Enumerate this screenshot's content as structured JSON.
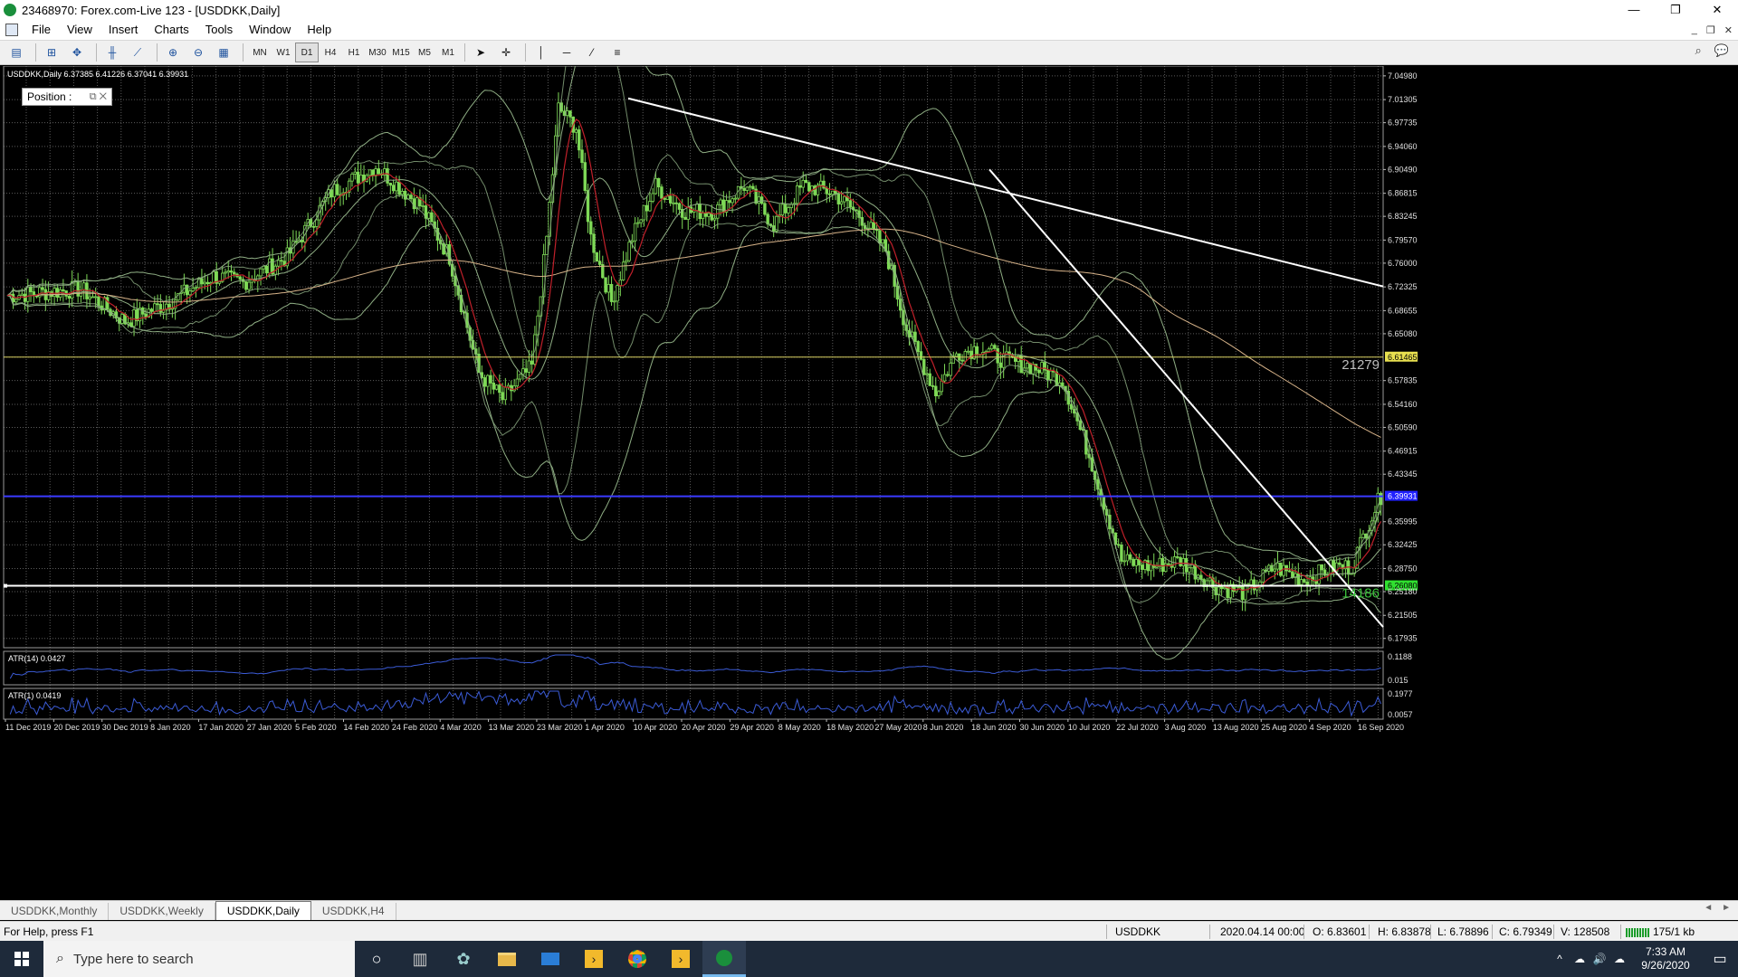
{
  "window": {
    "title": "23468970: Forex.com-Live 123 - [USDDKK,Daily]",
    "controls": [
      "—",
      "❐",
      "✕"
    ]
  },
  "menu": {
    "items": [
      "File",
      "View",
      "Insert",
      "Charts",
      "Tools",
      "Window",
      "Help"
    ],
    "mdi_controls": [
      "_",
      "❐",
      "✕"
    ]
  },
  "toolbar": {
    "timeframes": [
      "MN",
      "W1",
      "D1",
      "H4",
      "H1",
      "M30",
      "M15",
      "M5",
      "M1"
    ],
    "active_timeframe": "D1"
  },
  "chart": {
    "info": "USDDKK,Daily  6.37385 6.41226 6.37041 6.39931",
    "position_widget": "Position :",
    "price_labels": [
      "7.04980",
      "7.01305",
      "6.97735",
      "6.94060",
      "6.90490",
      "6.86815",
      "6.83245",
      "6.79570",
      "6.76000",
      "6.72325",
      "6.68655",
      "6.65080",
      "6.61465",
      "6.57835",
      "6.54160",
      "6.50590",
      "6.46915",
      "6.43345",
      "6.39931",
      "6.35995",
      "6.32425",
      "6.28750",
      "6.26080",
      "6.25180",
      "6.21505",
      "6.17935"
    ],
    "highlight_labels": {
      "yellow": "6.61465",
      "blue": "6.39931",
      "green": "6.26080"
    },
    "line_labels": {
      "upper": "21279",
      "lower": "14186"
    },
    "date_labels": [
      "11 Dec 2019",
      "20 Dec 2019",
      "30 Dec 2019",
      "8 Jan 2020",
      "17 Jan 2020",
      "27 Jan 2020",
      "5 Feb 2020",
      "14 Feb 2020",
      "24 Feb 2020",
      "4 Mar 2020",
      "13 Mar 2020",
      "23 Mar 2020",
      "1 Apr 2020",
      "10 Apr 2020",
      "20 Apr 2020",
      "29 Apr 2020",
      "8 May 2020",
      "18 May 2020",
      "27 May 2020",
      "8 Jun 2020",
      "18 Jun 2020",
      "30 Jun 2020",
      "10 Jul 2020",
      "22 Jul 2020",
      "3 Aug 2020",
      "13 Aug 2020",
      "25 Aug 2020",
      "4 Sep 2020",
      "16 Sep 2020"
    ],
    "atr14": {
      "label": "ATR(14) 0.0427",
      "scale": [
        "0.1188",
        "0.015"
      ]
    },
    "atr1": {
      "label": "ATR(1) 0.0419",
      "scale": [
        "0.1977",
        "0.0057"
      ]
    },
    "colors": {
      "candle": "#7ed957",
      "grid": "#7a7a7a",
      "trend": "#ffffff",
      "ma_fast": "#c0202a",
      "ma_slow": "#d8b48a",
      "band": "#8fae84",
      "hline_yellow": "#d8d060",
      "hline_blue": "#3a3aff",
      "atr": "#3b5bd6"
    }
  },
  "chart_data": {
    "type": "candlestick",
    "symbol": "USDDKK",
    "timeframe": "Daily",
    "ohlc_last": {
      "open": 6.37385,
      "high": 6.41226,
      "low": 6.37041,
      "close": 6.39931
    },
    "path": [
      [
        0,
        6.71
      ],
      [
        25,
        6.72
      ],
      [
        40,
        6.67
      ],
      [
        55,
        6.7
      ],
      [
        70,
        6.74
      ],
      [
        80,
        6.73
      ],
      [
        95,
        6.77
      ],
      [
        110,
        6.87
      ],
      [
        125,
        6.91
      ],
      [
        140,
        6.85
      ],
      [
        150,
        6.77
      ],
      [
        160,
        6.59
      ],
      [
        168,
        6.55
      ],
      [
        178,
        6.6
      ],
      [
        183,
        6.8
      ],
      [
        187,
        7.0
      ],
      [
        193,
        6.97
      ],
      [
        198,
        6.8
      ],
      [
        205,
        6.7
      ],
      [
        212,
        6.8
      ],
      [
        220,
        6.88
      ],
      [
        230,
        6.84
      ],
      [
        240,
        6.84
      ],
      [
        250,
        6.88
      ],
      [
        260,
        6.82
      ],
      [
        270,
        6.88
      ],
      [
        280,
        6.87
      ],
      [
        290,
        6.83
      ],
      [
        298,
        6.78
      ],
      [
        305,
        6.66
      ],
      [
        315,
        6.56
      ],
      [
        322,
        6.62
      ],
      [
        330,
        6.63
      ],
      [
        338,
        6.61
      ],
      [
        348,
        6.6
      ],
      [
        358,
        6.58
      ],
      [
        368,
        6.45
      ],
      [
        378,
        6.3
      ],
      [
        388,
        6.29
      ],
      [
        398,
        6.3
      ],
      [
        410,
        6.26
      ],
      [
        420,
        6.25
      ],
      [
        430,
        6.29
      ],
      [
        440,
        6.27
      ],
      [
        450,
        6.29
      ],
      [
        456,
        6.29
      ],
      [
        462,
        6.36
      ],
      [
        466,
        6.4
      ]
    ],
    "trendlines": [
      {
        "from": [
          "13 Mar 2020",
          7.015
        ],
        "to": [
          "end",
          6.724
        ]
      },
      {
        "from": [
          "8 May 2020",
          6.905
        ],
        "to": [
          "end",
          6.197
        ]
      }
    ],
    "horizontal_levels": [
      6.61465,
      6.39931,
      6.2608
    ],
    "atr14_last": 0.0427,
    "atr1_last": 0.0419
  },
  "tabs": {
    "items": [
      "USDDKK,Monthly",
      "USDDKK,Weekly",
      "USDDKK,Daily",
      "USDDKK,H4"
    ],
    "active": "USDDKK,Daily",
    "arrows": [
      "◄",
      "►"
    ]
  },
  "status": {
    "help": "For Help, press F1",
    "symbol": "USDDKK",
    "datetime": "2020.04.14 00:00",
    "open": "O: 6.83601",
    "high": "H: 6.83878",
    "low": "L: 6.78896",
    "close": "C: 6.79349",
    "volume": "V: 128508",
    "traffic": "175/1 kb"
  },
  "taskbar": {
    "search_placeholder": "Type here to search",
    "time": "7:33 AM",
    "date": "9/26/2020",
    "tray_icons": [
      "^",
      "☁",
      "🔊",
      "☁"
    ]
  }
}
